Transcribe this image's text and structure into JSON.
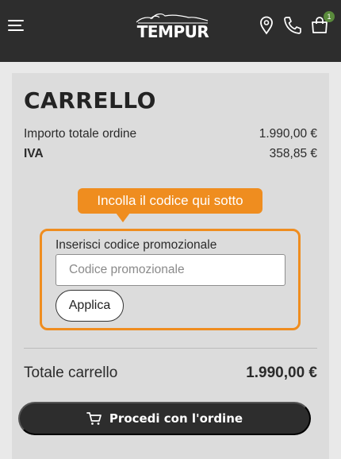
{
  "header": {
    "logo_text": "TEMPUR",
    "cart_count": "1"
  },
  "cart": {
    "title": "CARRELLO",
    "order_total_label": "Importo totale ordine",
    "order_total_value": "1.990,00 €",
    "vat_label": "IVA",
    "vat_value": "358,85 €"
  },
  "promo": {
    "tooltip": "Incolla il codice qui sotto",
    "label": "Inserisci codice promozionale",
    "placeholder": "Codice promozionale",
    "apply_label": "Applica"
  },
  "summary": {
    "total_label": "Totale carrello",
    "total_value": "1.990,00 €"
  },
  "checkout": {
    "label": "Procedi con l'ordine"
  },
  "colors": {
    "header_bg": "#2d2d2d",
    "accent_orange": "#ef8d1f",
    "badge_green": "#5a8b3c"
  },
  "icons": {
    "menu": "hamburger-icon",
    "location": "location-pin-icon",
    "phone": "phone-icon",
    "cart": "shopping-bag-icon",
    "checkout": "shopping-cart-icon"
  }
}
